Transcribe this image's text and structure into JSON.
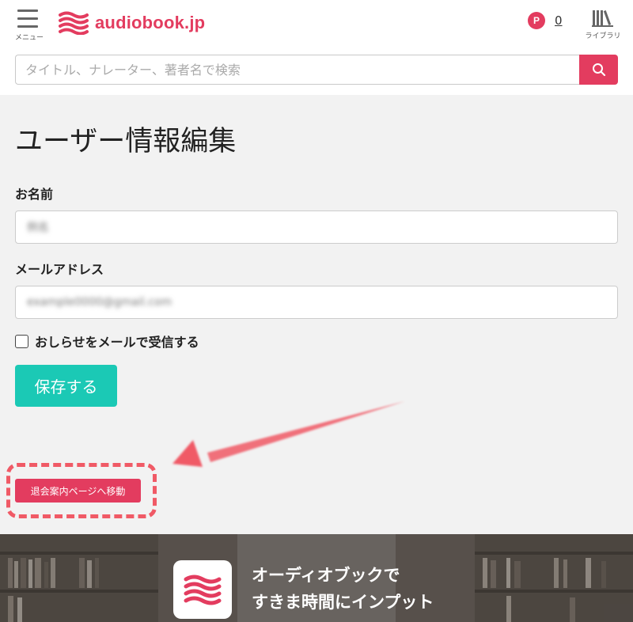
{
  "header": {
    "menu_label": "メニュー",
    "logo_text": "audiobook.jp",
    "points_icon_letter": "P",
    "points_count": "0",
    "library_label": "ライブラリ"
  },
  "search": {
    "placeholder": "タイトル、ナレーター、著者名で検索"
  },
  "form": {
    "title": "ユーザー情報編集",
    "name_label": "お名前",
    "name_value": "例名",
    "email_label": "メールアドレス",
    "email_value": "example0000@gmail.com",
    "newsletter_label": "おしらせをメールで受信する",
    "save_label": "保存する",
    "withdraw_label": "退会案内ページへ移動"
  },
  "banner": {
    "line1": "オーディオブックで",
    "line2": "すきま時間にインプット"
  },
  "colors": {
    "brand": "#e33c5f",
    "save": "#1bc9b5",
    "highlight": "#f05a66"
  }
}
